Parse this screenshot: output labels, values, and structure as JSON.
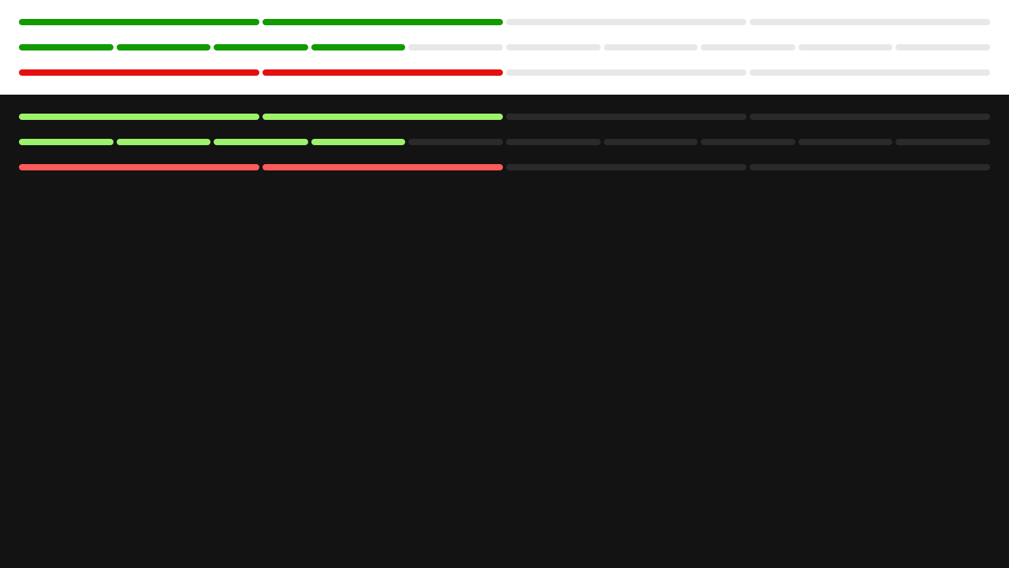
{
  "themes": [
    {
      "name": "light",
      "background": "#ffffff",
      "empty_color": "#e8e8e8",
      "meters": [
        {
          "name": "meter-success-4",
          "status": "success",
          "total_segments": 4,
          "filled_segments": 2,
          "fill_color": "#129a00"
        },
        {
          "name": "meter-success-10",
          "status": "success",
          "total_segments": 10,
          "filled_segments": 4,
          "fill_color": "#129a00"
        },
        {
          "name": "meter-error-4",
          "status": "error",
          "total_segments": 4,
          "filled_segments": 2,
          "fill_color": "#e50f0f"
        }
      ]
    },
    {
      "name": "dark",
      "background": "#131313",
      "empty_color": "#2a2a2a",
      "meters": [
        {
          "name": "meter-success-4",
          "status": "success",
          "total_segments": 4,
          "filled_segments": 2,
          "fill_color": "#9cf36a"
        },
        {
          "name": "meter-success-10",
          "status": "success",
          "total_segments": 10,
          "filled_segments": 4,
          "fill_color": "#9cf36a"
        },
        {
          "name": "meter-error-4",
          "status": "error",
          "total_segments": 4,
          "filled_segments": 2,
          "fill_color": "#ff5a5a"
        }
      ]
    }
  ]
}
